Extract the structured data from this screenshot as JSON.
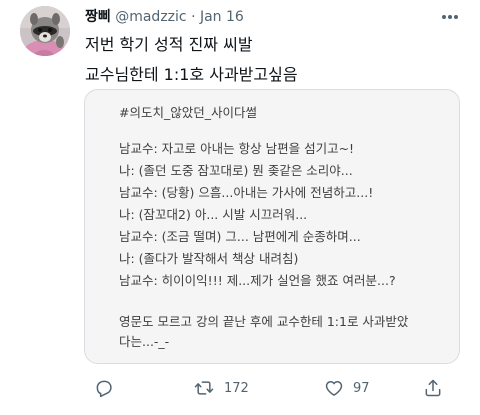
{
  "tweet": {
    "author_name": "짱삐",
    "handle": "@madzzic",
    "separator": "·",
    "date": "Jan 16",
    "text_lines": [
      "저번 학기 성적 진짜 씨발",
      "교수님한테 1:1호 사과받고싶음"
    ]
  },
  "attachment": {
    "lines": [
      "#의도치_않았던_사이다썰",
      "",
      "남교수: 자고로 아내는 항상 남편을 섬기고~!",
      "나: (졸던 도중 잠꼬대로) 뭔 좆같은 소리야...",
      "남교수: (당황) 으흠...아내는 가사에 전념하고...!",
      "나: (잠꼬대2) 아... 시발 시끄러워...",
      "남교수: (조금 떨며) 그... 남편에게 순종하며...",
      "나: (졸다가 발작해서 책상 내려침)",
      "남교수: 히이이익!!! 제...제가 실언을 했죠 여러분...?",
      "",
      "영문도 모르고 강의 끝난 후에 교수한테 1:1로 사과받았",
      "다는...-_-"
    ]
  },
  "actions": {
    "reply": {
      "icon": "reply-icon"
    },
    "retweet": {
      "icon": "retweet-icon",
      "count": "172"
    },
    "like": {
      "icon": "heart-icon",
      "count": "97"
    },
    "share": {
      "icon": "share-icon"
    }
  },
  "colors": {
    "text": "#0f1419",
    "secondary": "#536471",
    "card_bg": "#f5f5f5",
    "card_border": "#d9dde1"
  }
}
